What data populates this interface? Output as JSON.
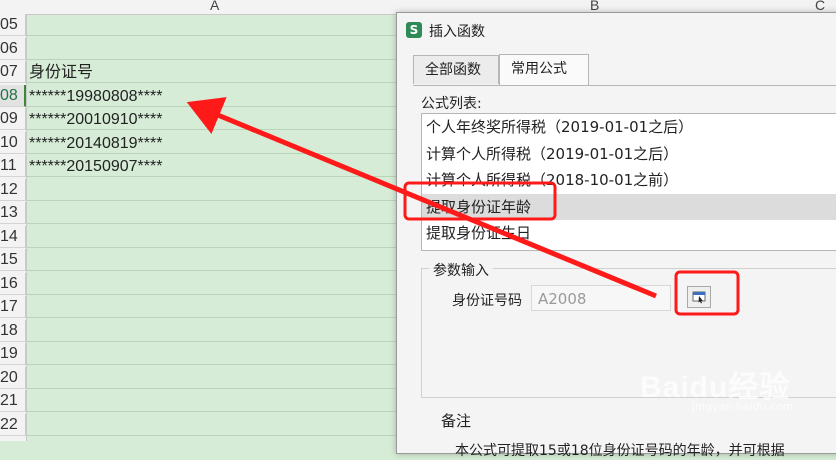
{
  "sheet": {
    "columns": [
      {
        "letter": "A"
      },
      {
        "letter": "B"
      },
      {
        "letter": "C"
      }
    ],
    "rows": [
      {
        "num": "05",
        "value": ""
      },
      {
        "num": "06",
        "value": ""
      },
      {
        "num": "07",
        "value": "身份证号"
      },
      {
        "num": "08",
        "value": "******19980808****"
      },
      {
        "num": "09",
        "value": "******20010910****"
      },
      {
        "num": "10",
        "value": "******20140819****"
      },
      {
        "num": "11",
        "value": "******20150907****"
      },
      {
        "num": "12",
        "value": ""
      },
      {
        "num": "13",
        "value": ""
      },
      {
        "num": "14",
        "value": ""
      },
      {
        "num": "15",
        "value": ""
      },
      {
        "num": "16",
        "value": ""
      },
      {
        "num": "17",
        "value": ""
      },
      {
        "num": "18",
        "value": ""
      },
      {
        "num": "19",
        "value": ""
      },
      {
        "num": "20",
        "value": ""
      },
      {
        "num": "21",
        "value": ""
      },
      {
        "num": "22",
        "value": ""
      }
    ],
    "active_row": "08"
  },
  "dialog": {
    "app_icon": "S",
    "title": "插入函数",
    "tabs": [
      {
        "label": "全部函数",
        "active": false
      },
      {
        "label": "常用公式",
        "active": true
      }
    ],
    "list_label": "公式列表:",
    "formulas": [
      "个人年终奖所得税（2019-01-01之后）",
      "计算个人所得税（2019-01-01之后）",
      "计算个人所得税（2018-10-01之前）",
      "提取身份证年龄",
      "提取身份证生日"
    ],
    "selected_formula_index": 3,
    "params_title": "参数输入",
    "param_label": "身份证号码",
    "param_value": "A2008",
    "remarks_title": "备注",
    "remarks_text": "本公式可提取15或18位身份证号码的年龄，并可根据"
  },
  "watermark": {
    "logo": "Baidu经验",
    "sub": "jingyan.baidu.com"
  },
  "colors": {
    "sheet_bg": "#d6ecd6",
    "annotation_red": "#ff1a1a",
    "selected_row": "#dcdcdc"
  }
}
